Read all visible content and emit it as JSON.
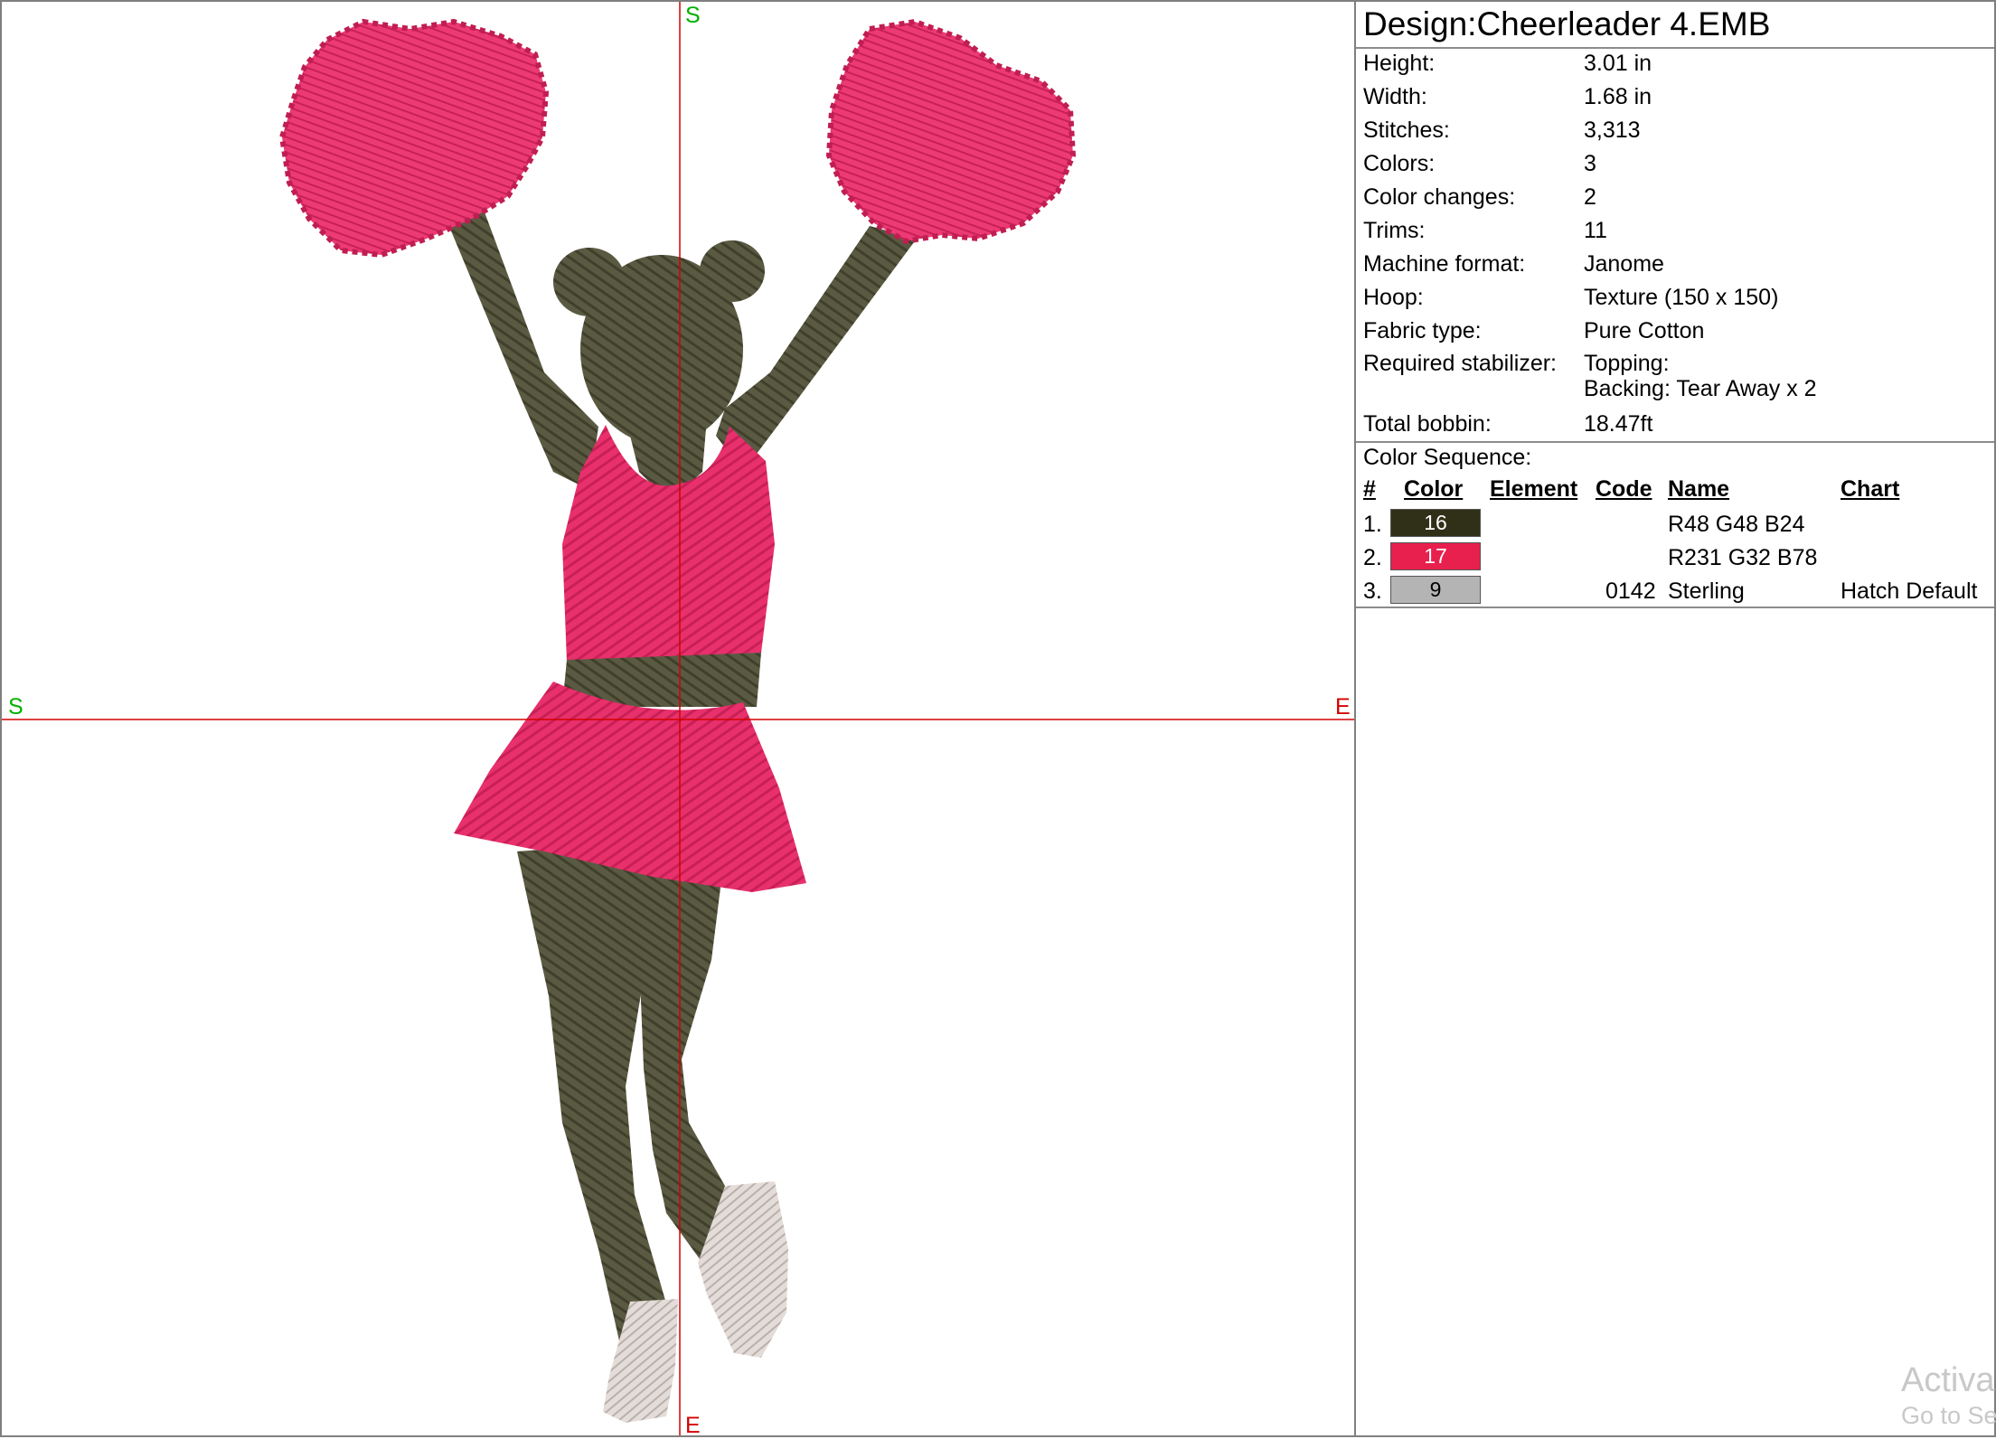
{
  "design": {
    "title": "Design:Cheerleader 4.EMB",
    "axis_top": "S",
    "axis_left": "S",
    "axis_right": "E",
    "axis_bottom": "E"
  },
  "colors": {
    "body": "#5a5a42",
    "pink": "#e8306c",
    "pink_dark": "#c01e52",
    "shoe": "#d9d0cc",
    "axis": "#d40000"
  },
  "info": [
    {
      "label": "Height:",
      "value": "3.01 in"
    },
    {
      "label": "Width:",
      "value": "1.68 in"
    },
    {
      "label": "Stitches:",
      "value": "3,313"
    },
    {
      "label": "Colors:",
      "value": "3"
    },
    {
      "label": "Color changes:",
      "value": "2"
    },
    {
      "label": "Trims:",
      "value": "11"
    },
    {
      "label": "Machine format:",
      "value": "Janome"
    },
    {
      "label": "Hoop:",
      "value": "Texture (150 x 150)"
    },
    {
      "label": "Fabric type:",
      "value": "Pure Cotton"
    }
  ],
  "stabilizer": {
    "label": "Required stabilizer:",
    "line1": "Topping:",
    "line2": "Backing: Tear Away x 2"
  },
  "bobbin": {
    "label": "Total bobbin:",
    "value": "18.47ft"
  },
  "sequence": {
    "label": "Color Sequence:",
    "headers": {
      "num": "#",
      "color": "Color",
      "element": "Element",
      "code": "Code",
      "name": "Name",
      "chart": "Chart"
    },
    "rows": [
      {
        "num": "1.",
        "color_number": "16",
        "swatch": "#303018",
        "text_color": "#ffffff",
        "code": "",
        "name": "R48 G48 B24",
        "chart": ""
      },
      {
        "num": "2.",
        "color_number": "17",
        "swatch": "#e7204e",
        "text_color": "#ffffff",
        "code": "",
        "name": "R231 G32 B78",
        "chart": ""
      },
      {
        "num": "3.",
        "color_number": "9",
        "swatch": "#b4b4b4",
        "text_color": "#000000",
        "code": "0142",
        "name": "Sterling",
        "chart": "Hatch Default"
      }
    ]
  },
  "watermark": {
    "line1": "Activa",
    "line2": "Go to Se"
  }
}
